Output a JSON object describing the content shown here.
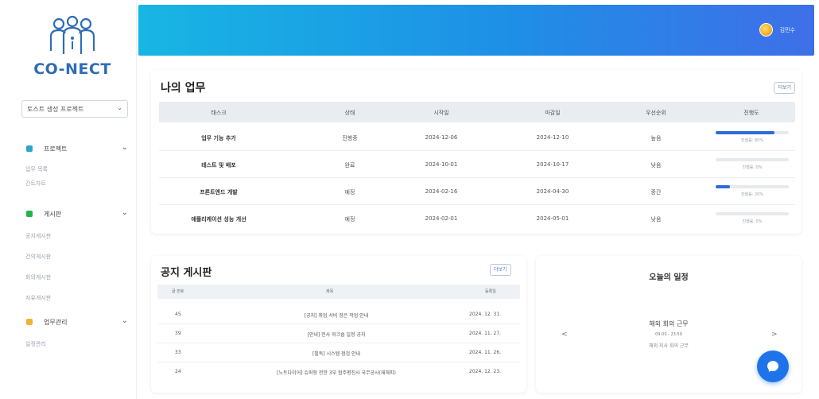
{
  "brand": {
    "logo_text": "CO-NECT"
  },
  "sidebar": {
    "project_select": "토스트 생성 프로젝트",
    "groups": [
      {
        "label": "프로젝트",
        "icon": "project-icon",
        "color": "#2aa6c9",
        "items": [
          "업무 목록",
          "간트차트"
        ]
      },
      {
        "label": "게시판",
        "icon": "board-icon",
        "color": "#27b24a",
        "items": [
          "공지게시판",
          "건의게시판",
          "회의게시판",
          "자유게시판"
        ]
      },
      {
        "label": "업무관리",
        "icon": "folder-icon",
        "color": "#f2b233",
        "items": [
          "일정관리"
        ]
      }
    ],
    "collapse_icon": "⌄"
  },
  "header": {
    "username": "김민수"
  },
  "tasks": {
    "title": "나의 업무",
    "more_label": "더보기",
    "columns": [
      "태스크",
      "상태",
      "시작일",
      "마감일",
      "우선순위",
      "진행도"
    ],
    "rows": [
      {
        "task": "업무 기능 추가",
        "status": "진행중",
        "start": "2024-12-06",
        "end": "2024-12-10",
        "priority": "높음",
        "progress": 80,
        "progress_label": "진행률: 80%"
      },
      {
        "task": "테스트 및 배포",
        "status": "완료",
        "start": "2024-10-01",
        "end": "2024-10-17",
        "priority": "낮음",
        "progress": 0,
        "progress_label": "진행률: 0%"
      },
      {
        "task": "프론트엔드 개발",
        "status": "예정",
        "start": "2024-02-16",
        "end": "2024-04-30",
        "priority": "중간",
        "progress": 20,
        "progress_label": "진행률: 20%"
      },
      {
        "task": "애플리케이션 성능 개선",
        "status": "예정",
        "start": "2024-02-01",
        "end": "2024-05-01",
        "priority": "낮음",
        "progress": 0,
        "progress_label": "진행률: 0%"
      }
    ]
  },
  "notice": {
    "title": "공지 게시판",
    "more_label": "더보기",
    "columns": [
      "글 번호",
      "제목",
      "등록일"
    ],
    "rows": [
      {
        "no": "45",
        "title": "[공지] 취업 서비 정은 작업 안내",
        "date": "2024. 12. 31."
      },
      {
        "no": "39",
        "title": "[안내] 전사 워크숍 일정 공지",
        "date": "2024. 11. 27."
      },
      {
        "no": "33",
        "title": "[필독] 시스템 점검 안내",
        "date": "2024. 11. 26."
      },
      {
        "no": "24",
        "title": "[노트다이어] 슈퍼형 전한 3부 협주평진사 국무공사(재해피)",
        "date": "2024. 12. 23."
      }
    ]
  },
  "schedule": {
    "title": "오늘의 일정",
    "prev": "<",
    "next": ">",
    "event_title": "해외 회의 근무",
    "event_time": "09:00 - 23:59",
    "event_desc": "해외 지사 회의 근무"
  },
  "colors": {
    "header_start": "#17b6e3",
    "header_end": "#3f6fe8",
    "accent": "#1f73e8",
    "progress": "#2f6bd8"
  }
}
